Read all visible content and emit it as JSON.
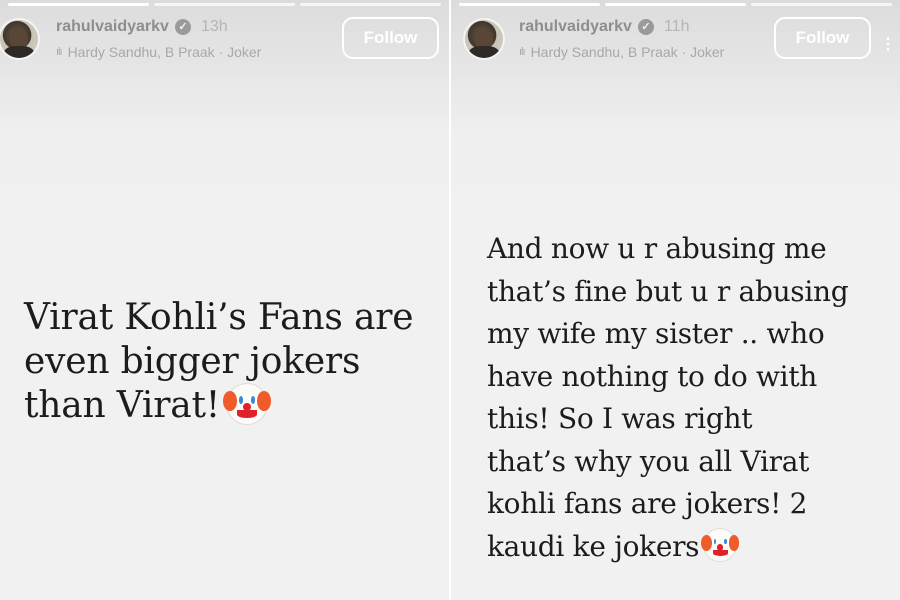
{
  "stories": [
    {
      "username": "rahulvaidyarkv",
      "time": "13h",
      "music": "Hardy Sandhu, B Praak · Joker",
      "follow_label": "Follow",
      "lines": [
        "Virat Kohli’s Fans are",
        "even bigger jokers",
        "than Virat!"
      ],
      "trailing_emoji": "clown-face"
    },
    {
      "username": "rahulvaidyarkv",
      "time": "11h",
      "music": "Hardy Sandhu, B Praak · Joker",
      "follow_label": "Follow",
      "lines": [
        "And now u r abusing me",
        "that’s fine but u r abusing",
        "my wife my sister .. who",
        "have nothing to do with",
        "this! So I was right",
        "that’s why you all Virat",
        "kohli fans are jokers! 2",
        "kaudi ke jokers"
      ],
      "trailing_emoji": "clown-face"
    }
  ],
  "icons": {
    "verified": "verified-badge-icon",
    "music": "music-bars-icon",
    "more": "more-options-icon",
    "clown": "clown-face-icon"
  },
  "colors": {
    "story_bg": "#f1f1f1",
    "text": "#1c1c1c",
    "follow_border": "#ffffff",
    "username": "#8e8e8e"
  }
}
